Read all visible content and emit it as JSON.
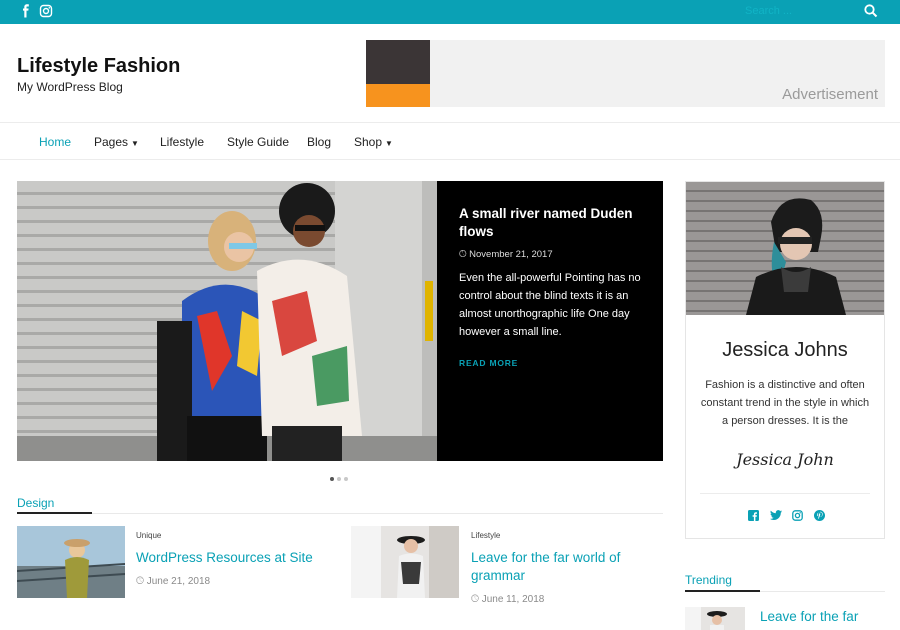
{
  "topbar": {
    "social_icons": [
      "facebook-icon",
      "instagram-icon"
    ],
    "search_placeholder": "Search ..."
  },
  "header": {
    "site_title": "Lifestyle Fashion",
    "tagline": "My WordPress Blog",
    "ad_label": "Advertisement"
  },
  "nav": {
    "items": [
      {
        "label": "Home",
        "active": true
      },
      {
        "label": "Pages",
        "has_submenu": true
      },
      {
        "label": "Lifestyle"
      },
      {
        "label": "Style Guide"
      },
      {
        "label": "Blog"
      },
      {
        "label": "Shop",
        "has_submenu": true
      }
    ]
  },
  "slider": {
    "title": "A small river named Duden flows",
    "date": "November 21, 2017",
    "excerpt": "Even the all-powerful Pointing has no control about the blind texts it is an almost unorthographic life One day however a small line.",
    "read_more": "READ MORE",
    "slide_count": 3,
    "active_slide": 1
  },
  "design": {
    "section_title": "Design",
    "posts": [
      {
        "category": "Unique",
        "title": "WordPress Resources at Site",
        "date": "June 21, 2018"
      },
      {
        "category": "Lifestyle",
        "title": "Leave for the far world of grammar",
        "date": "June 11, 2018"
      }
    ]
  },
  "about": {
    "name": "Jessica Johns",
    "text": "Fashion is a distinctive and often constant trend in the style in which a person dresses. It is the",
    "signature": "Jessica John",
    "social_icons": [
      "facebook-icon",
      "twitter-icon",
      "instagram-icon",
      "pinterest-icon"
    ]
  },
  "trending": {
    "section_title": "Trending",
    "post_title": "Leave for the far"
  },
  "colors": {
    "accent": "#0aa1b5",
    "dark": "#111111"
  }
}
